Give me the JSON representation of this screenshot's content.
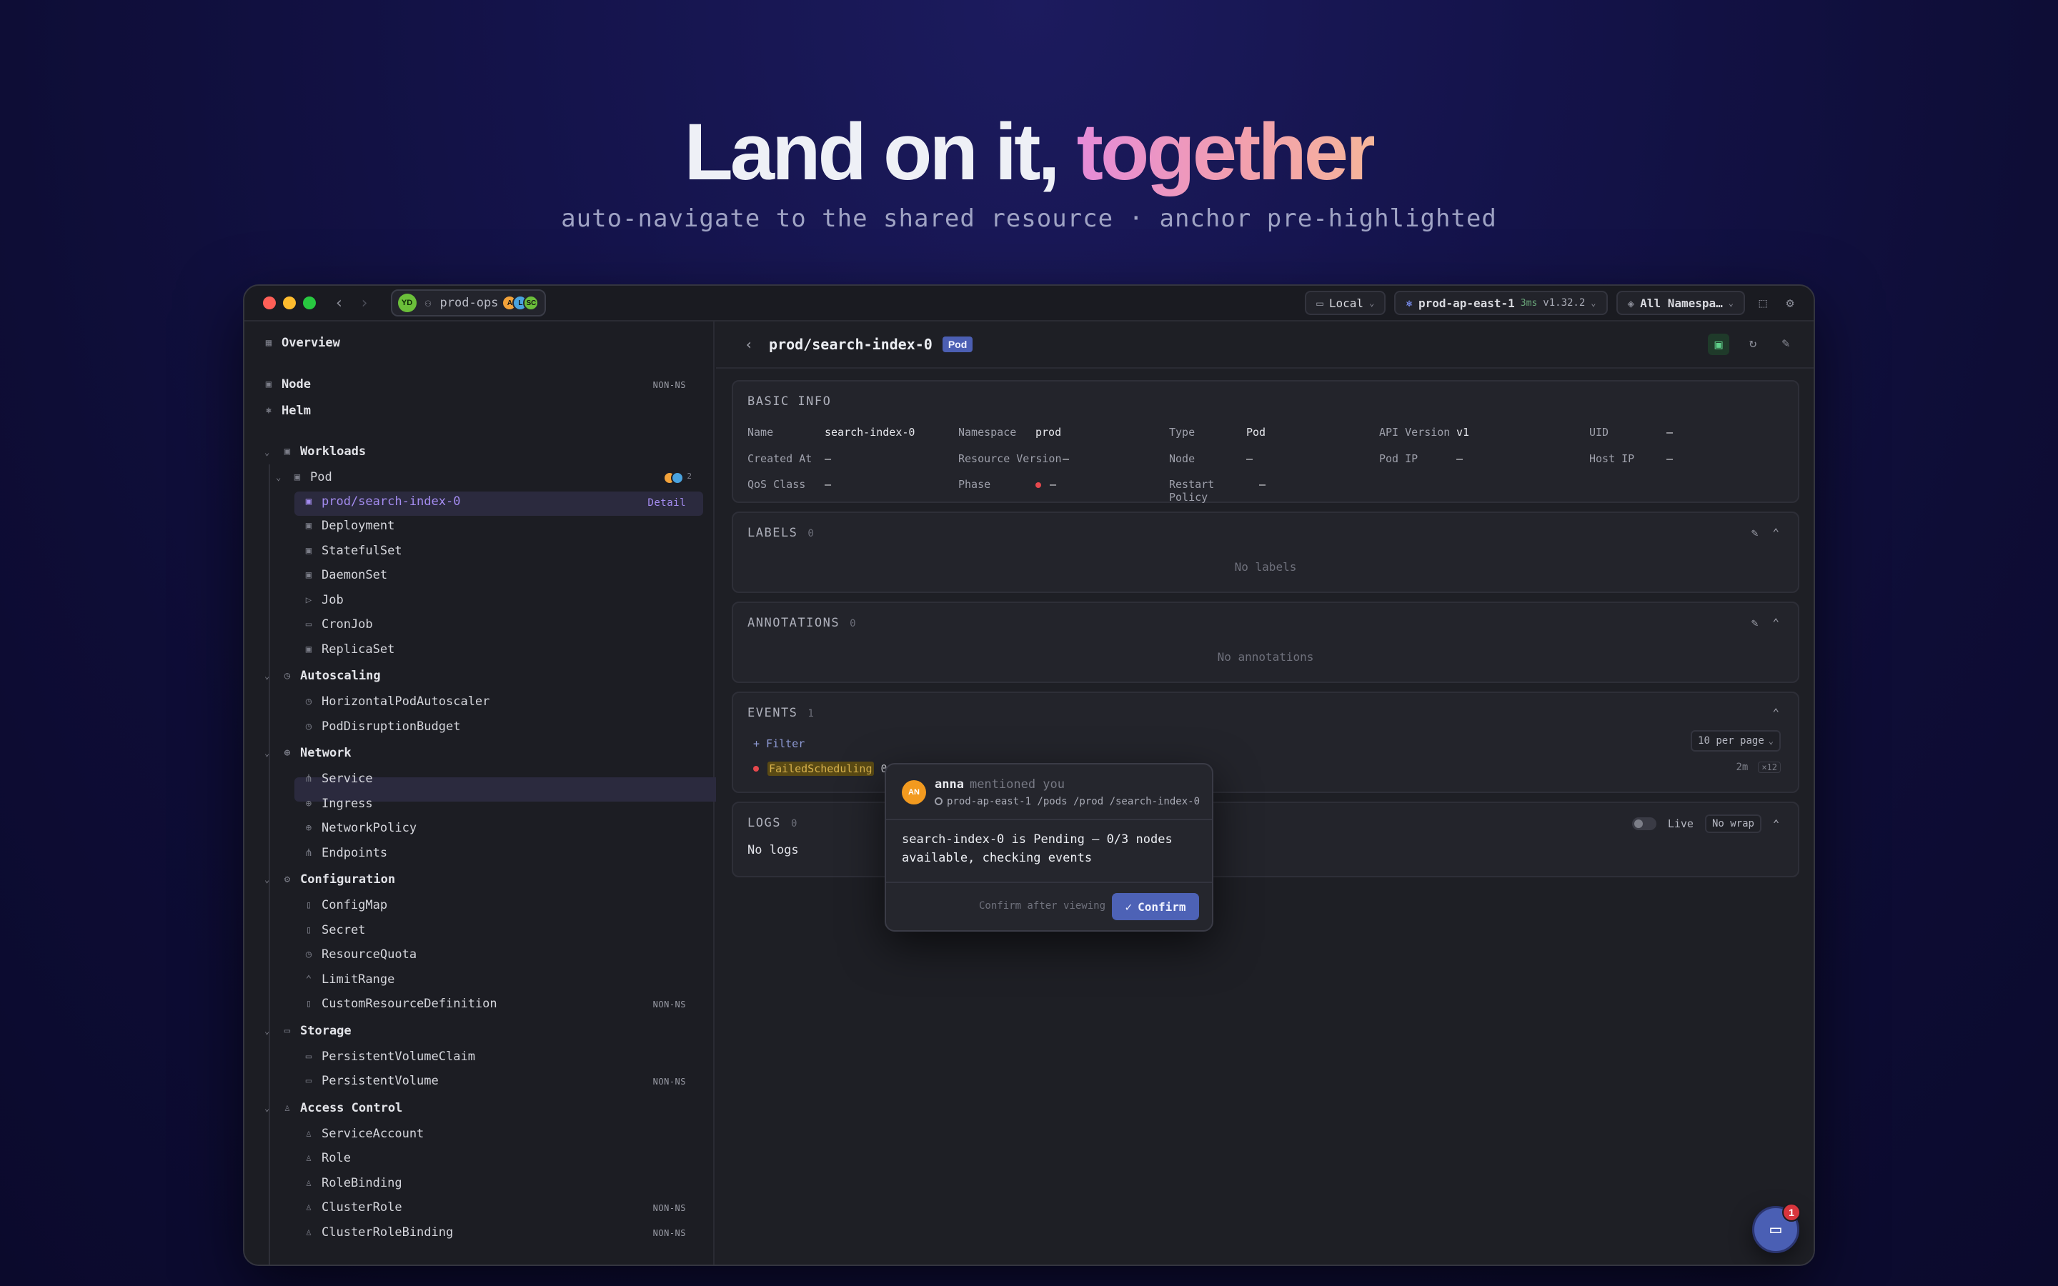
{
  "hero": {
    "title_main": "Land on it, ",
    "title_accent": "together",
    "subtitle": "auto-navigate to the shared resource · anchor pre-highlighted"
  },
  "titlebar": {
    "room_avatar": "YD",
    "room_name": "prod-ops",
    "participants": [
      "A",
      "L",
      "SC"
    ],
    "context": "Local",
    "cluster": "prod-ap-east-1",
    "latency": "3ms",
    "version": "v1.32.2",
    "namespace": "All Namespa…"
  },
  "sidebar": {
    "overview": "Overview",
    "node": "Node",
    "helm": "Helm",
    "non_ns": "NON-NS",
    "workloads": "Workloads",
    "pod": "Pod",
    "pod_viewers": "2",
    "active_item": "prod/search-index-0",
    "active_tag": "Detail",
    "workload_items": [
      "Deployment",
      "StatefulSet",
      "DaemonSet",
      "Job",
      "CronJob",
      "ReplicaSet"
    ],
    "autoscaling": "Autoscaling",
    "autoscaling_items": [
      "HorizontalPodAutoscaler",
      "PodDisruptionBudget"
    ],
    "network": "Network",
    "network_items": [
      "Service",
      "Ingress",
      "NetworkPolicy",
      "Endpoints"
    ],
    "configuration": "Configuration",
    "configuration_items": [
      "ConfigMap",
      "Secret",
      "ResourceQuota",
      "LimitRange",
      "CustomResourceDefinition"
    ],
    "storage": "Storage",
    "storage_items": [
      "PersistentVolumeClaim",
      "PersistentVolume"
    ],
    "access": "Access Control",
    "access_items": [
      "ServiceAccount",
      "Role",
      "RoleBinding",
      "ClusterRole",
      "ClusterRoleBinding"
    ]
  },
  "detail": {
    "title": "prod/search-index-0",
    "kind": "Pod",
    "basic_info": "BASIC INFO",
    "fields": {
      "name_k": "Name",
      "name_v": "search-index-0",
      "ns_k": "Namespace",
      "ns_v": "prod",
      "type_k": "Type",
      "type_v": "Pod",
      "api_k": "API Version",
      "api_v": "v1",
      "uid_k": "UID",
      "uid_v": "—",
      "created_k": "Created At",
      "created_v": "—",
      "rv_k": "Resource Version",
      "rv_v": "—",
      "node_k": "Node",
      "node_v": "—",
      "podip_k": "Pod IP",
      "podip_v": "—",
      "hostip_k": "Host IP",
      "hostip_v": "—",
      "qos_k": "QoS Class",
      "qos_v": "—",
      "phase_k": "Phase",
      "phase_v": "—",
      "restart_k": "Restart Policy",
      "restart_v": "—"
    },
    "labels": "LABELS",
    "labels_count": "0",
    "labels_empty": "No labels",
    "annotations": "ANNOTATIONS",
    "annotations_count": "0",
    "annotations_empty": "No annotations",
    "events": "EVENTS",
    "events_count": "1",
    "filter": "+ Filter",
    "per_page": "10 per page",
    "event_reason": "FailedScheduling",
    "event_text": "0/",
    "event_age": "2m",
    "event_count": "×12",
    "logs": "LOGS",
    "logs_count": "0",
    "logs_empty": "No logs",
    "live": "Live",
    "no_wrap": "No wrap"
  },
  "mention": {
    "avatar": "AN",
    "user": "anna",
    "action": "mentioned you",
    "path": "prod-ap-east-1 /pods /prod /search-index-0",
    "message": "search-index-0 is Pending — 0/3 nodes available, checking events",
    "hint": "Confirm after viewing",
    "confirm": "Confirm"
  },
  "chat": {
    "unread": "1"
  }
}
